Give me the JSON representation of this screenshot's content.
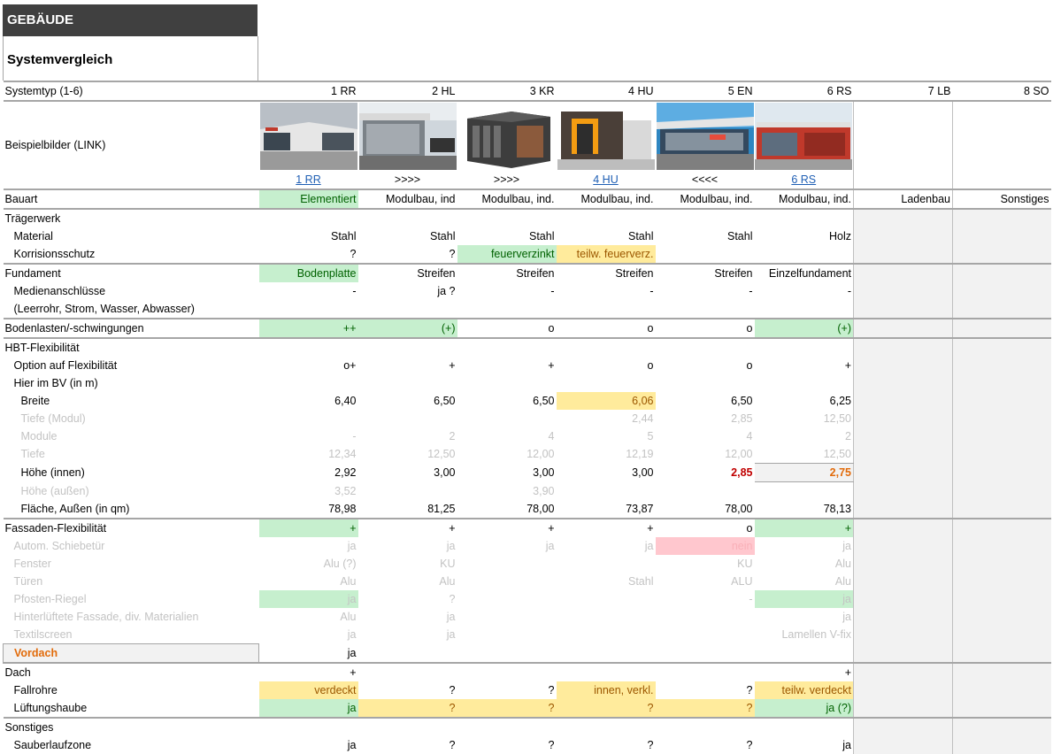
{
  "header": {
    "title": "GEBÄUDE",
    "subtitle": "Systemvergleich"
  },
  "columns": [
    "1 RR",
    "2 HL",
    "3 KR",
    "4 HU",
    "5 EN",
    "6 RS",
    "7 LB",
    "8 SO"
  ],
  "rows": {
    "systemtyp": "Systemtyp (1-6)",
    "beispiel": "Beispielbilder (LINK)",
    "links": [
      "1 RR",
      ">>>>",
      ">>>>",
      "4 HU",
      "<<<<",
      "6 RS"
    ],
    "bauart": {
      "label": "Bauart",
      "v": [
        "Elementiert",
        "Modulbau, ind",
        "Modulbau, ind.",
        "Modulbau, ind.",
        "Modulbau, ind.",
        "Modulbau, ind.",
        "Ladenbau",
        "Sonstiges"
      ]
    },
    "traeger": "Trägerwerk",
    "material": {
      "label": "Material",
      "v": [
        "Stahl",
        "Stahl",
        "Stahl",
        "Stahl",
        "Stahl",
        "Holz"
      ]
    },
    "korrision": {
      "label": "Korrisionsschutz",
      "v": [
        "?",
        "?",
        "feuerverzinkt",
        "teilw.  feuerverz.",
        "",
        ""
      ]
    },
    "fundament": {
      "label": "Fundament",
      "v": [
        "Bodenplatte",
        "Streifen",
        "Streifen",
        "Streifen",
        "Streifen",
        "Einzelfundament"
      ]
    },
    "medien": {
      "label": "Medienanschlüsse",
      "v": [
        "-",
        "ja ?",
        "-",
        "-",
        "-",
        "-"
      ]
    },
    "medien2": "(Leerrohr, Strom, Wasser, Abwasser)",
    "bodenlasten": {
      "label": "Bodenlasten/-schwingungen",
      "v": [
        "++",
        "(+)",
        "o",
        "o",
        "o",
        "(+)"
      ]
    },
    "hbt": "HBT-Flexibilität",
    "option": {
      "label": "Option auf Flexibilität",
      "v": [
        "o+",
        "+",
        "+",
        "o",
        "o",
        "+"
      ]
    },
    "hier": "Hier im BV (in m)",
    "breite": {
      "label": "Breite",
      "v": [
        "6,40",
        "6,50",
        "6,50",
        "6,06",
        "6,50",
        "6,25"
      ]
    },
    "tiefe_modul": {
      "label": "Tiefe (Modul)",
      "v": [
        "",
        "",
        "",
        "2,44",
        "2,85",
        "12,50"
      ]
    },
    "module": {
      "label": "Module",
      "v": [
        "-",
        "2",
        "4",
        "5",
        "4",
        "2"
      ]
    },
    "tiefe": {
      "label": "Tiefe",
      "v": [
        "12,34",
        "12,50",
        "12,00",
        "12,19",
        "12,00",
        "12,50"
      ]
    },
    "hoehe_innen": {
      "label": "Höhe (innen)",
      "v": [
        "2,92",
        "3,00",
        "3,00",
        "3,00",
        "2,85",
        "2,75"
      ]
    },
    "hoehe_aussen": {
      "label": "Höhe (außen)",
      "v": [
        "3,52",
        "",
        "3,90",
        "",
        "",
        ""
      ]
    },
    "flaeche": {
      "label": "Fläche, Außen (in qm)",
      "v": [
        "78,98",
        "81,25",
        "78,00",
        "73,87",
        "78,00",
        "78,13"
      ]
    },
    "fassade": {
      "label": "Fassaden-Flexibilität",
      "v": [
        "+",
        "+",
        "+",
        "+",
        "o",
        "+"
      ]
    },
    "schiebe": {
      "label": "Autom. Schiebetür",
      "v": [
        "ja",
        "ja",
        "ja",
        "ja",
        "nein",
        "ja"
      ]
    },
    "fenster": {
      "label": "Fenster",
      "v": [
        "Alu (?)",
        "KU",
        "",
        "",
        "KU",
        "Alu"
      ]
    },
    "tueren": {
      "label": "Türen",
      "v": [
        "Alu",
        "Alu",
        "",
        "Stahl",
        "ALU",
        "Alu"
      ]
    },
    "pfosten": {
      "label": "Pfosten-Riegel",
      "v": [
        "ja",
        "?",
        "",
        "",
        "-",
        "ja"
      ]
    },
    "hinter": {
      "label": "Hinterlüftete Fassade, div. Materialien",
      "v": [
        "Alu",
        "ja",
        "",
        "",
        "",
        "ja"
      ]
    },
    "textil": {
      "label": "Textilscreen",
      "v": [
        "ja",
        "ja",
        "",
        "",
        "",
        "Lamellen V-fix"
      ]
    },
    "vordach": {
      "label": "Vordach",
      "v": [
        "ja",
        "",
        "",
        "",
        "",
        ""
      ]
    },
    "dach": {
      "label": "Dach",
      "v": [
        "+",
        "",
        "",
        "",
        "",
        "+"
      ]
    },
    "fallrohre": {
      "label": "Fallrohre",
      "v": [
        "verdeckt",
        "?",
        "?",
        "innen, verkl.",
        "?",
        "teilw. verdeckt"
      ]
    },
    "lueftung": {
      "label": "Lüftungshaube",
      "v": [
        "ja",
        "?",
        "?",
        "?",
        "?",
        "ja (?)"
      ]
    },
    "sonstiges": "Sonstiges",
    "sauber": {
      "label": "Sauberlaufzone",
      "v": [
        "ja",
        "?",
        "?",
        "?",
        "?",
        "ja"
      ]
    }
  }
}
